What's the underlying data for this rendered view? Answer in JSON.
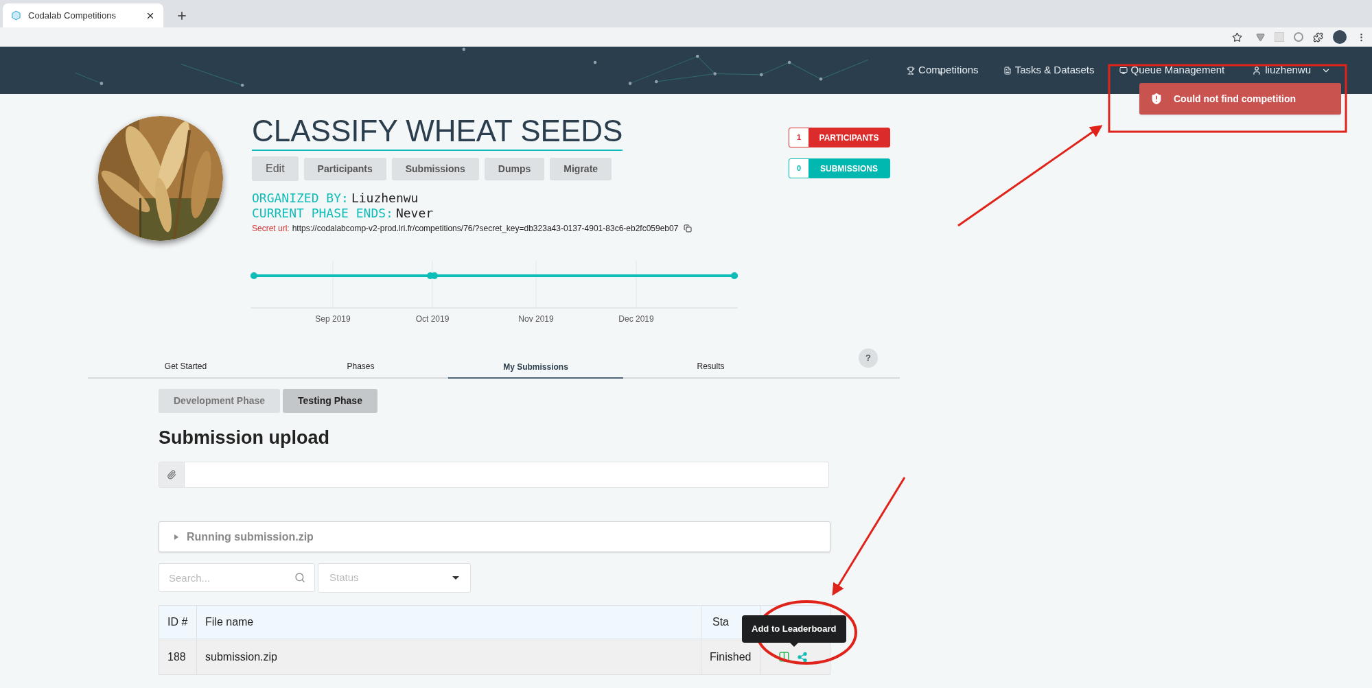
{
  "browser": {
    "tab_title": "Codalab Competitions"
  },
  "nav": {
    "items": [
      {
        "label": "Competitions"
      },
      {
        "label": "Tasks & Datasets"
      },
      {
        "label": "Queue Management"
      }
    ],
    "user": "liuzhenwu"
  },
  "toast": {
    "message": "Could not find competition"
  },
  "competition": {
    "title": "CLASSIFY WHEAT SEEDS",
    "buttons": [
      "Edit",
      "Participants",
      "Submissions",
      "Dumps",
      "Migrate"
    ],
    "organized_by": {
      "label": "ORGANIZED BY:",
      "value": "Liuzhenwu"
    },
    "phase_ends": {
      "label": "CURRENT PHASE ENDS:",
      "value": "Never"
    },
    "secret_url": {
      "label": "Secret url:",
      "value": "https://codalabcomp-v2-prod.lri.fr/competitions/76/?secret_key=db323a43-0137-4901-83c6-eb2fc059eb07"
    }
  },
  "stats": [
    {
      "count": "1",
      "label": "PARTICIPANTS",
      "color": "#dc2b2b"
    },
    {
      "count": "0",
      "label": "SUBMISSIONS",
      "color": "#00b8b0"
    }
  ],
  "timeline": {
    "ticks": [
      "Sep 2019",
      "Oct 2019",
      "Nov 2019",
      "Dec 2019"
    ]
  },
  "tabs": [
    {
      "label": "Get Started",
      "selected": false
    },
    {
      "label": "Phases",
      "selected": false
    },
    {
      "label": "My Submissions",
      "selected": true
    },
    {
      "label": "Results",
      "selected": false
    }
  ],
  "help": "?",
  "phases": [
    {
      "label": "Development Phase",
      "selected": false
    },
    {
      "label": "Testing Phase",
      "selected": true
    }
  ],
  "upload": {
    "heading": "Submission upload"
  },
  "running": {
    "label": "Running submission.zip",
    "expanded": false
  },
  "filters": {
    "search_placeholder": "Search...",
    "status_placeholder": "Status"
  },
  "table": {
    "columns": [
      "ID #",
      "File name",
      "Sta"
    ],
    "rows": [
      {
        "number": "188",
        "file": "submission.zip",
        "status": "Finished"
      }
    ]
  },
  "tooltip": {
    "text": "Add to Leaderboard"
  }
}
